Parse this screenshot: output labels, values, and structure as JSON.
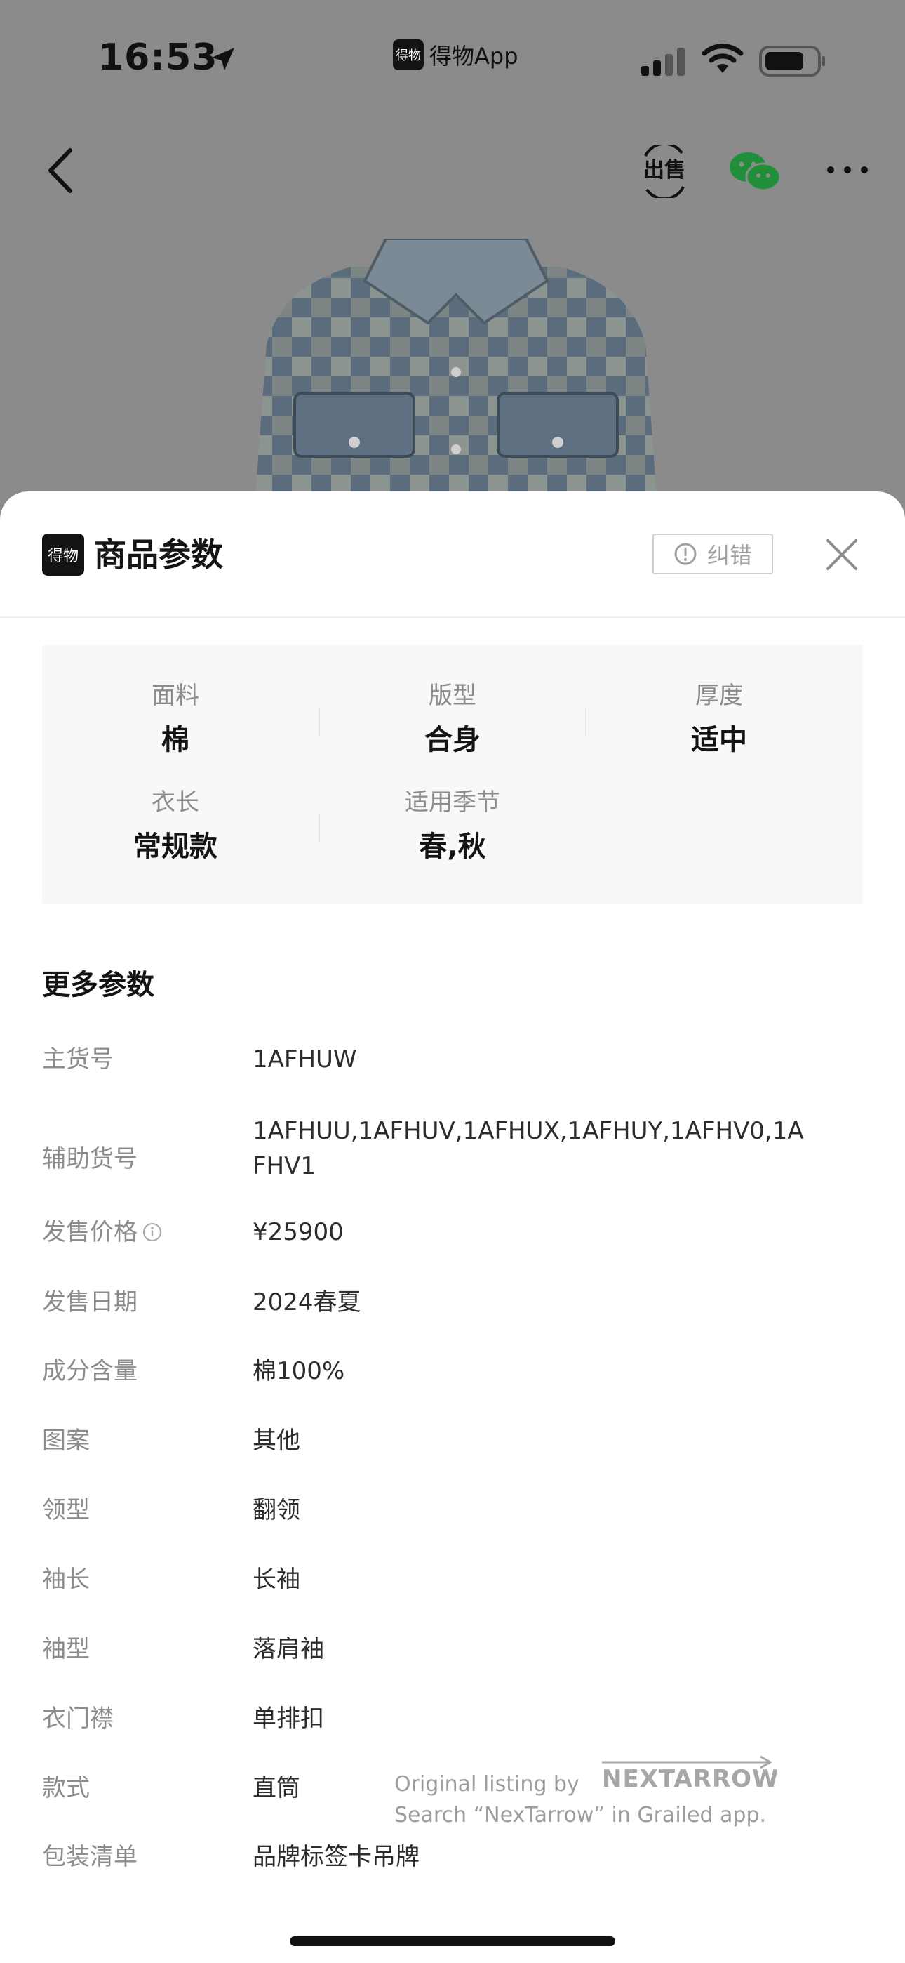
{
  "status_bar": {
    "time": "16:53",
    "app_name": "得物App",
    "app_logo_text": "得物"
  },
  "nav": {
    "sell_label": "出售"
  },
  "sheet": {
    "logo_text": "得物",
    "title": "商品参数",
    "report_label": "纠错"
  },
  "specs": [
    {
      "label": "面料",
      "value": "棉"
    },
    {
      "label": "版型",
      "value": "合身"
    },
    {
      "label": "厚度",
      "value": "适中"
    },
    {
      "label": "衣长",
      "value": "常规款"
    },
    {
      "label": "适用季节",
      "value": "春,秋"
    }
  ],
  "more_params": {
    "title": "更多参数",
    "rows": [
      {
        "key": "主货号",
        "value": "1AFHUW"
      },
      {
        "key": "辅助货号",
        "value": "1AFHUU,1AFHUV,1AFHUX,1AFHUY,1AFHV0,1AFHV1"
      },
      {
        "key": "发售价格",
        "value": "¥25900"
      },
      {
        "key": "发售日期",
        "value": "2024春夏"
      },
      {
        "key": "成分含量",
        "value": "棉100%"
      },
      {
        "key": "图案",
        "value": "其他"
      },
      {
        "key": "领型",
        "value": "翻领"
      },
      {
        "key": "袖长",
        "value": "长袖"
      },
      {
        "key": "袖型",
        "value": "落肩袖"
      },
      {
        "key": "衣门襟",
        "value": "单排扣"
      },
      {
        "key": "款式",
        "value": "直筒"
      },
      {
        "key": "包装清单",
        "value": "品牌标签卡吊牌"
      }
    ]
  },
  "watermark": {
    "line1": "Original listing by",
    "brand": "NEXTARROW",
    "line2": "Search “NexTarrow” in Grailed app."
  }
}
